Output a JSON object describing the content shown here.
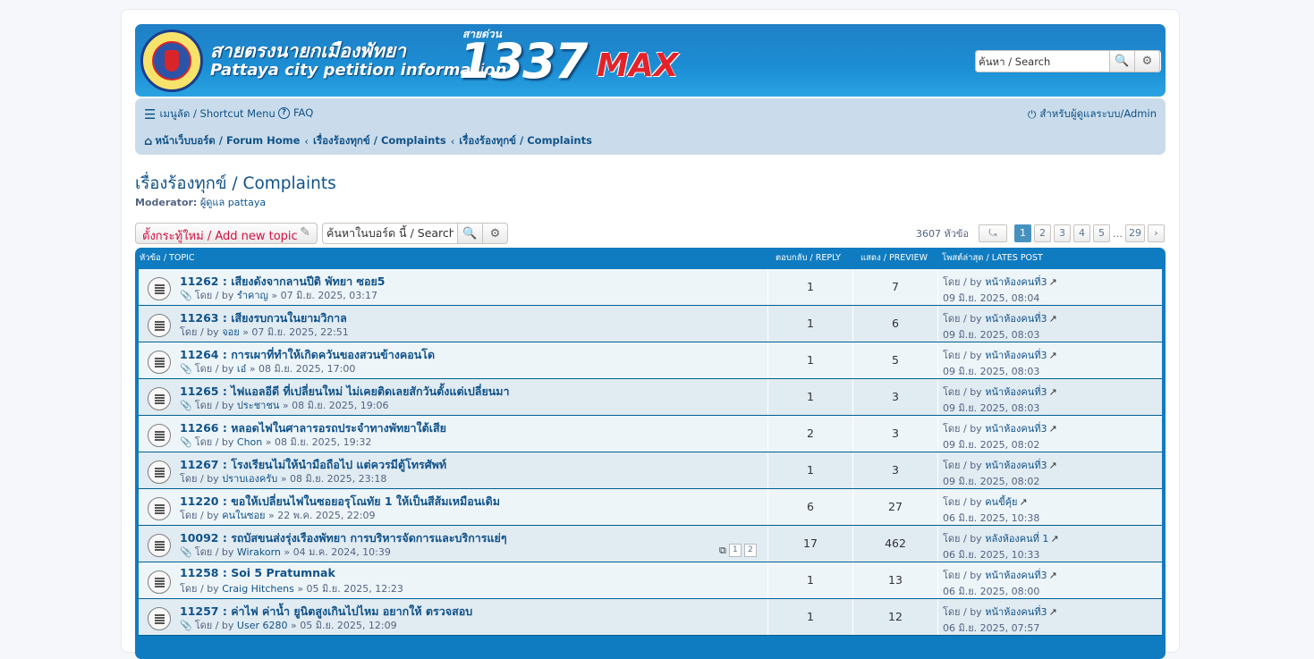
{
  "header": {
    "site_name_th": "สายตรงนายกเมืองพัทยา",
    "site_name_en": "Pattaya city petition information",
    "hotline_label": "สายด่วน",
    "hotline_number": "1337",
    "hotline_suffix": "MAX",
    "search_placeholder": "ค้นหา / Search",
    "colors": {
      "header_blue": "#1c8ed4",
      "max_red": "#e4222a"
    }
  },
  "nav": {
    "menu_label": "เมนูลัด / Shortcut Menu",
    "faq_label": "FAQ",
    "admin_label": "สำหรับผู้ดูแลระบบ/Admin",
    "breadcrumbs": [
      "หน้าเว็บบอร์ด / Forum Home",
      "เรื่องร้องทุกข์ / Complaints",
      "เรื่องร้องทุกข์ / Complaints"
    ]
  },
  "forum": {
    "title": "เรื่องร้องทุกข์ / Complaints",
    "moderator_label": "Moderator:",
    "moderator_value": "ผู้ดูแล pattaya",
    "new_topic_label": "ตั้งกระทู้ใหม่ / Add new topic",
    "search_value": "ค้นหาในบอร์ด นี้ / Search",
    "topic_count": "3607 หัวข้อ",
    "pages": [
      "1",
      "2",
      "3",
      "4",
      "5",
      "29"
    ],
    "ellipsis": "…"
  },
  "table": {
    "col_topic": "หัวข้อ / TOPIC",
    "col_reply": "ตอบกลับ / REPLY",
    "col_view": "แสดง / PREVIEW",
    "col_last": "โพสต์ล่าสุด / LATES POST",
    "rows": [
      {
        "title": "11262 : เสียงดังจากลานปีติ พัทยา ซอย5",
        "by": "โดย / by",
        "author": "รำคาญ",
        "date": "» 07 มิ.ย. 2025, 03:17",
        "clip": true,
        "replies": "1",
        "views": "7",
        "last_by": "โดย / by",
        "last_author": "หน้าห้องคนที่3",
        "last_date": "09 มิ.ย. 2025, 08:04"
      },
      {
        "title": "11263 : เสียงรบกวนในยามวิกาล",
        "by": "โดย / by",
        "author": "จอย",
        "date": "» 07 มิ.ย. 2025, 22:51",
        "clip": false,
        "replies": "1",
        "views": "6",
        "last_by": "โดย / by",
        "last_author": "หน้าห้องคนที่3",
        "last_date": "09 มิ.ย. 2025, 08:03"
      },
      {
        "title": "11264 : การเผาที่ทำให้เกิดควันของสวนข้างคอนโด",
        "by": "โดย / by",
        "author": "เอ๋",
        "date": "» 08 มิ.ย. 2025, 17:00",
        "clip": true,
        "replies": "1",
        "views": "5",
        "last_by": "โดย / by",
        "last_author": "หน้าห้องคนที่3",
        "last_date": "09 มิ.ย. 2025, 08:03"
      },
      {
        "title": "11265 : ไฟแอลอีดี ที่เปลี่ยนใหม่ ไม่เคยติดเลยสักวันตั้งแต่เปลี่ยนมา",
        "by": "โดย / by",
        "author": "ประชาชน",
        "date": "» 08 มิ.ย. 2025, 19:06",
        "clip": true,
        "replies": "1",
        "views": "3",
        "last_by": "โดย / by",
        "last_author": "หน้าห้องคนที่3",
        "last_date": "09 มิ.ย. 2025, 08:03"
      },
      {
        "title": "11266 : หลอดไฟในศาลารอรถประจำทางพัทยาใต้เสีย",
        "by": "โดย / by",
        "author": "Chon",
        "date": "» 08 มิ.ย. 2025, 19:32",
        "clip": true,
        "replies": "2",
        "views": "3",
        "last_by": "โดย / by",
        "last_author": "หน้าห้องคนที่3",
        "last_date": "09 มิ.ย. 2025, 08:02"
      },
      {
        "title": "11267 : โรงเรียนไม่ให้นำมือถือไป แต่ควรมีตู้โทรศัพท์",
        "by": "โดย / by",
        "author": "ปราบเองครับ",
        "date": "» 08 มิ.ย. 2025, 23:18",
        "clip": false,
        "replies": "1",
        "views": "3",
        "last_by": "โดย / by",
        "last_author": "หน้าห้องคนที่3",
        "last_date": "09 มิ.ย. 2025, 08:02"
      },
      {
        "title": "11220 : ขอให้เปลี่ยนไฟในซอยอรุโณทัย 1 ให้เป็นสีส้มเหมือนเดิม",
        "by": "โดย / by",
        "author": "คนในซอย",
        "date": "» 22 พ.ค. 2025, 22:09",
        "clip": false,
        "replies": "6",
        "views": "27",
        "last_by": "โดย / by",
        "last_author": "คนขี้คุ้ย",
        "last_date": "06 มิ.ย. 2025, 10:38"
      },
      {
        "title": "10092 : รถบัสขนส่งรุ่งเรืองพัทยา การบริหารจัดการและบริการแย่ๆ",
        "by": "โดย / by",
        "author": "Wirakorn",
        "date": "» 04 ม.ค. 2024, 10:39",
        "clip": true,
        "replies": "17",
        "views": "462",
        "last_by": "โดย / by",
        "last_author": "หลังห้องคนที่ 1",
        "last_date": "06 มิ.ย. 2025, 10:33",
        "minipages": [
          "1",
          "2"
        ]
      },
      {
        "title": "11258 : Soi 5 Pratumnak",
        "by": "โดย / by",
        "author": "Craig Hitchens",
        "date": "» 05 มิ.ย. 2025, 12:23",
        "clip": false,
        "replies": "1",
        "views": "13",
        "last_by": "โดย / by",
        "last_author": "หน้าห้องคนที่3",
        "last_date": "06 มิ.ย. 2025, 08:00"
      },
      {
        "title": "11257 : ค่าไฟ ค่าน้ำ ยูนิตสูงเกินไปไหม อยากให้ ตรวจสอบ",
        "by": "โดย / by",
        "author": "User 6280",
        "date": "» 05 มิ.ย. 2025, 12:09",
        "clip": true,
        "replies": "1",
        "views": "12",
        "last_by": "โดย / by",
        "last_author": "หน้าห้องคนที่3",
        "last_date": "06 มิ.ย. 2025, 07:57"
      }
    ]
  }
}
